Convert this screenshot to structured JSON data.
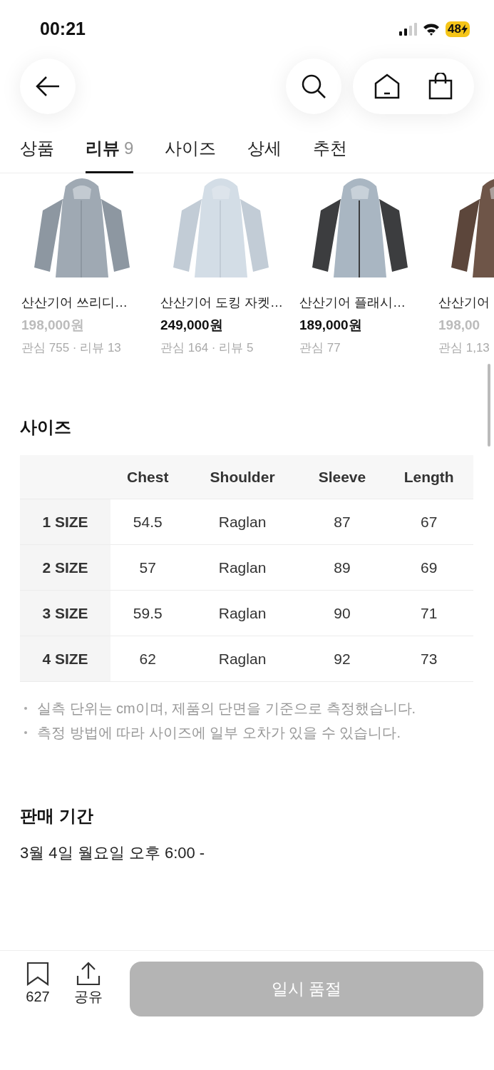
{
  "status_bar": {
    "time": "00:21",
    "battery": "48"
  },
  "tabs": [
    {
      "label": "상품",
      "selected": false
    },
    {
      "label": "리뷰",
      "count": "9",
      "selected": true
    },
    {
      "label": "사이즈",
      "selected": false
    },
    {
      "label": "상세",
      "selected": false
    },
    {
      "label": "추천",
      "selected": false
    }
  ],
  "products": [
    {
      "name": "산산기어 쓰리디…",
      "price": "198,000원",
      "sold_out": true,
      "stats": "관심 755 · 리뷰 13"
    },
    {
      "name": "산산기어 도킹 자켓…",
      "price": "249,000원",
      "sold_out": false,
      "stats": "관심 164 · 리뷰 5"
    },
    {
      "name": "산산기어 플래시…",
      "price": "189,000원",
      "sold_out": false,
      "stats": "관심 77"
    },
    {
      "name": "산산기어",
      "price": "198,00",
      "sold_out": true,
      "stats": "관심 1,13"
    }
  ],
  "size_section": {
    "title": "사이즈",
    "columns": [
      "Chest",
      "Shoulder",
      "Sleeve",
      "Length"
    ],
    "rows": [
      {
        "label": "1 SIZE",
        "cells": [
          "54.5",
          "Raglan",
          "87",
          "67"
        ]
      },
      {
        "label": "2 SIZE",
        "cells": [
          "57",
          "Raglan",
          "89",
          "69"
        ]
      },
      {
        "label": "3 SIZE",
        "cells": [
          "59.5",
          "Raglan",
          "90",
          "71"
        ]
      },
      {
        "label": "4 SIZE",
        "cells": [
          "62",
          "Raglan",
          "92",
          "73"
        ]
      }
    ],
    "notes": [
      "실측 단위는 cm이며, 제품의 단면을 기준으로 측정했습니다.",
      "측정 방법에 따라 사이즈에 일부 오차가 있을 수 있습니다."
    ]
  },
  "sale_period": {
    "title": "판매 기간",
    "value": "3월 4일 월요일 오후 6:00 -"
  },
  "bottom_bar": {
    "bookmark_count": "627",
    "share_label": "공유",
    "buy_button": {
      "label": "일시 품절",
      "disabled": true
    }
  }
}
